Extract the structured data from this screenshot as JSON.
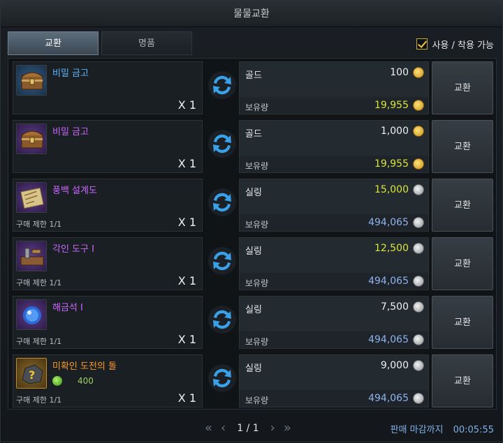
{
  "window": {
    "title": "물물교환"
  },
  "tabs": [
    {
      "label": "교환",
      "active": true
    },
    {
      "label": "명품",
      "active": false
    }
  ],
  "option": {
    "label": "사용 / 착용 가능",
    "checked": true
  },
  "exchange_label": "교환",
  "held_label": "보유량",
  "rows": [
    {
      "item_name": "비밀 금고",
      "name_color": "#5fb6ff",
      "icon": "treasure-chest-icon",
      "icon_bg": "blue",
      "qty": "X 1",
      "limit": "",
      "sub_value": "",
      "currency": "골드",
      "coin": "gold",
      "price": "100",
      "price_color": "#eef0f2",
      "held": "19,955",
      "held_color": "#d9e63a"
    },
    {
      "item_name": "비밀 금고",
      "name_color": "#cc66ff",
      "icon": "treasure-chest-icon",
      "icon_bg": "purple",
      "qty": "X 1",
      "limit": "",
      "sub_value": "",
      "currency": "골드",
      "coin": "gold",
      "price": "1,000",
      "price_color": "#eef0f2",
      "held": "19,955",
      "held_color": "#d9e63a"
    },
    {
      "item_name": "풍백 설계도",
      "name_color": "#cc66ff",
      "icon": "blueprint-scroll-icon",
      "icon_bg": "purple",
      "qty": "X 1",
      "limit": "구매 제한 1/1",
      "sub_value": "",
      "currency": "실링",
      "coin": "silver",
      "price": "15,000",
      "price_color": "#d9e63a",
      "held": "494,065",
      "held_color": "#8fb3ee"
    },
    {
      "item_name": "각인 도구 I",
      "name_color": "#cc66ff",
      "icon": "engraving-tool-icon",
      "icon_bg": "purple",
      "qty": "X 1",
      "limit": "구매 제한 1/1",
      "sub_value": "",
      "currency": "실링",
      "coin": "silver",
      "price": "12,500",
      "price_color": "#d9e63a",
      "held": "494,065",
      "held_color": "#8fb3ee"
    },
    {
      "item_name": "해금석 I",
      "name_color": "#cc66ff",
      "icon": "crystal-orb-icon",
      "icon_bg": "purple",
      "qty": "X 1",
      "limit": "구매 제한 1/1",
      "sub_value": "",
      "currency": "실링",
      "coin": "silver",
      "price": "7,500",
      "price_color": "#eef0f2",
      "held": "494,065",
      "held_color": "#8fb3ee"
    },
    {
      "item_name": "미확인 도전의 돌",
      "name_color": "#ff9a2a",
      "icon": "unknown-stone-icon",
      "icon_bg": "gold",
      "qty": "X 1",
      "limit": "구매 제한 1/1",
      "sub_value": "400",
      "currency": "실링",
      "coin": "silver",
      "price": "9,000",
      "price_color": "#eef0f2",
      "held": "494,065",
      "held_color": "#8fb3ee"
    }
  ],
  "pager": {
    "first": "«",
    "prev": "‹",
    "page": "1 / 1",
    "next": "›",
    "last": "»"
  },
  "deadline": {
    "label": "판매 마감까지",
    "time": "00:05:55"
  }
}
